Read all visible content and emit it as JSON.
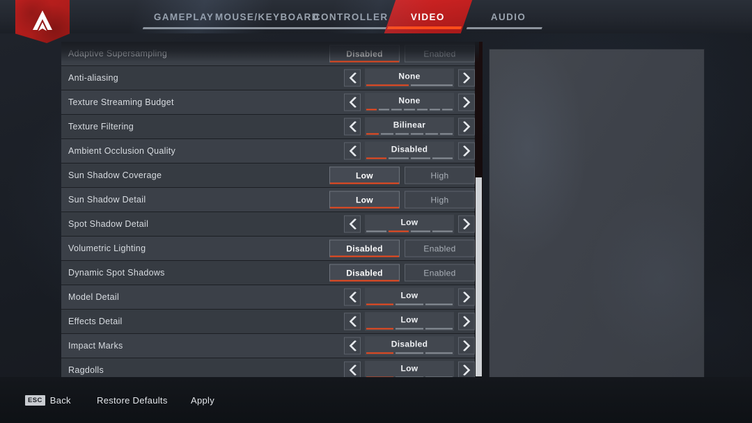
{
  "app": {
    "logo_icon": "apex-legends-logo",
    "accent_color": "#ef4a1e",
    "tab_active_color": "#cf2323"
  },
  "nav": {
    "tabs": [
      {
        "label": "GAMEPLAY",
        "active": false
      },
      {
        "label": "MOUSE/KEYBOARD",
        "active": false
      },
      {
        "label": "CONTROLLER",
        "active": false
      },
      {
        "label": "VIDEO",
        "active": true
      },
      {
        "label": "AUDIO",
        "active": false
      }
    ]
  },
  "settings": {
    "rows": [
      {
        "label": "Adaptive Supersampling",
        "type": "toggle",
        "options": [
          "Disabled",
          "Enabled"
        ],
        "selected": 0,
        "clipped": true
      },
      {
        "label": "Anti-aliasing",
        "type": "stepper",
        "value": "None",
        "segments": 2,
        "filled": 1
      },
      {
        "label": "Texture Streaming Budget",
        "type": "stepper",
        "value": "None",
        "segments": 7,
        "filled": 1
      },
      {
        "label": "Texture Filtering",
        "type": "stepper",
        "value": "Bilinear",
        "segments": 6,
        "filled": 1
      },
      {
        "label": "Ambient Occlusion Quality",
        "type": "stepper",
        "value": "Disabled",
        "segments": 4,
        "filled": 1
      },
      {
        "label": "Sun Shadow Coverage",
        "type": "toggle",
        "options": [
          "Low",
          "High"
        ],
        "selected": 0
      },
      {
        "label": "Sun Shadow Detail",
        "type": "toggle",
        "options": [
          "Low",
          "High"
        ],
        "selected": 0
      },
      {
        "label": "Spot Shadow Detail",
        "type": "stepper",
        "value": "Low",
        "segments": 4,
        "filled": 2,
        "filled_index": 1
      },
      {
        "label": "Volumetric Lighting",
        "type": "toggle",
        "options": [
          "Disabled",
          "Enabled"
        ],
        "selected": 0
      },
      {
        "label": "Dynamic Spot Shadows",
        "type": "toggle",
        "options": [
          "Disabled",
          "Enabled"
        ],
        "selected": 0
      },
      {
        "label": "Model Detail",
        "type": "stepper",
        "value": "Low",
        "segments": 3,
        "filled": 1
      },
      {
        "label": "Effects Detail",
        "type": "stepper",
        "value": "Low",
        "segments": 3,
        "filled": 1
      },
      {
        "label": "Impact Marks",
        "type": "stepper",
        "value": "Disabled",
        "segments": 3,
        "filled": 1
      },
      {
        "label": "Ragdolls",
        "type": "stepper",
        "value": "Low",
        "segments": 3,
        "filled": 1
      }
    ],
    "left_arrow_icon": "chevron-left-icon",
    "right_arrow_icon": "chevron-right-icon"
  },
  "scrollbar": {
    "thumb_position_percent": 40
  },
  "preview": {
    "content": ""
  },
  "footer": {
    "items": [
      {
        "key": "ESC",
        "label": "Back"
      },
      {
        "key": "",
        "label": "Restore Defaults"
      },
      {
        "key": "",
        "label": "Apply"
      }
    ]
  }
}
